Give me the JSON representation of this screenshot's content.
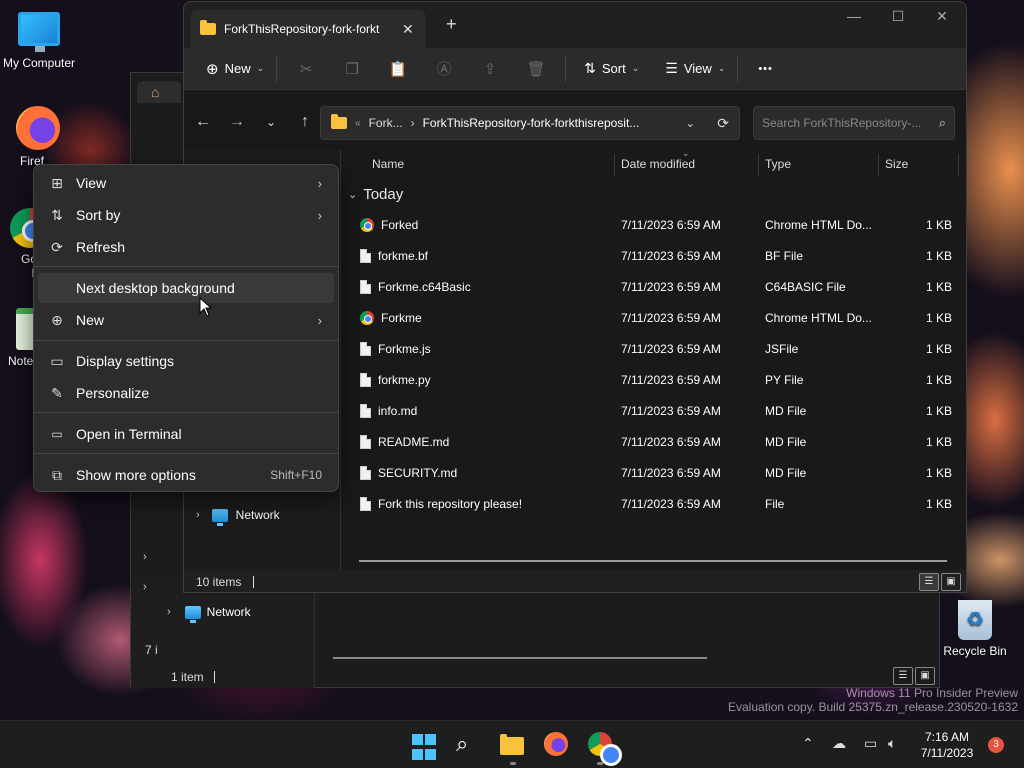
{
  "desktop": {
    "icons": [
      {
        "label": "My Computer",
        "icon": "monitor-icon"
      },
      {
        "label": "Firef",
        "icon": "firefox-icon"
      },
      {
        "label": "Go Ch",
        "icon": "chrome-icon"
      },
      {
        "label": "Note",
        "icon": "notepad-icon"
      },
      {
        "label": "Recycle Bin",
        "icon": "recycle-bin-icon"
      }
    ]
  },
  "back_window": {
    "network_label": "Network",
    "status_items": "1 item",
    "partial_count": "7 i"
  },
  "explorer": {
    "tab_title": "ForkThisRepository-fork-forkt",
    "toolbar": {
      "new_label": "New",
      "sort_label": "Sort",
      "view_label": "View",
      "more_label": "•••"
    },
    "address": {
      "crumb_root": "Fork...",
      "crumb_current": "ForkThisRepository-fork-forkthisreposit..."
    },
    "search": {
      "placeholder": "Search ForkThisRepository-..."
    },
    "nav": {
      "network_label": "Network"
    },
    "columns": {
      "name": "Name",
      "date": "Date modified",
      "type": "Type",
      "size": "Size"
    },
    "group_label": "Today",
    "files": [
      {
        "name": "Forked",
        "date": "7/11/2023 6:59 AM",
        "type": "Chrome HTML Do...",
        "size": "1 KB",
        "icon": "chrome"
      },
      {
        "name": "forkme.bf",
        "date": "7/11/2023 6:59 AM",
        "type": "BF File",
        "size": "1 KB",
        "icon": "page"
      },
      {
        "name": "Forkme.c64Basic",
        "date": "7/11/2023 6:59 AM",
        "type": "C64BASIC File",
        "size": "1 KB",
        "icon": "page"
      },
      {
        "name": "Forkme",
        "date": "7/11/2023 6:59 AM",
        "type": "Chrome HTML Do...",
        "size": "1 KB",
        "icon": "chrome"
      },
      {
        "name": "Forkme.js",
        "date": "7/11/2023 6:59 AM",
        "type": "JSFile",
        "size": "1 KB",
        "icon": "page"
      },
      {
        "name": "forkme.py",
        "date": "7/11/2023 6:59 AM",
        "type": "PY File",
        "size": "1 KB",
        "icon": "page"
      },
      {
        "name": "info.md",
        "date": "7/11/2023 6:59 AM",
        "type": "MD File",
        "size": "1 KB",
        "icon": "page"
      },
      {
        "name": "README.md",
        "date": "7/11/2023 6:59 AM",
        "type": "MD File",
        "size": "1 KB",
        "icon": "page"
      },
      {
        "name": "SECURITY.md",
        "date": "7/11/2023 6:59 AM",
        "type": "MD File",
        "size": "1 KB",
        "icon": "page"
      },
      {
        "name": "Fork this repository please!",
        "date": "7/11/2023 6:59 AM",
        "type": "File",
        "size": "1 KB",
        "icon": "page"
      }
    ],
    "status_count": "10 items"
  },
  "context_menu": {
    "items": [
      {
        "label": "View",
        "icon": "grid-icon",
        "submenu": true
      },
      {
        "label": "Sort by",
        "icon": "sort-icon",
        "submenu": true
      },
      {
        "label": "Refresh",
        "icon": "refresh-icon",
        "submenu": false
      },
      {
        "label": "Next desktop background",
        "icon": "blank",
        "submenu": false
      },
      {
        "label": "New",
        "icon": "plus-circle-icon",
        "submenu": true
      },
      {
        "label": "Display settings",
        "icon": "display-icon",
        "submenu": false
      },
      {
        "label": "Personalize",
        "icon": "brush-icon",
        "submenu": false
      },
      {
        "label": "Open in Terminal",
        "icon": "terminal-icon",
        "submenu": false
      },
      {
        "label": "Show more options",
        "icon": "more-options-icon",
        "submenu": false,
        "shortcut": "Shift+F10"
      }
    ]
  },
  "watermark": {
    "line1": "Windows 11 Pro Insider Preview",
    "line2": "Evaluation copy. Build 25375.zn_release.230520-1632"
  },
  "taskbar": {
    "time": "7:16 AM",
    "date": "7/11/2023",
    "notification_count": "3",
    "accent": "#4cc2ff"
  }
}
